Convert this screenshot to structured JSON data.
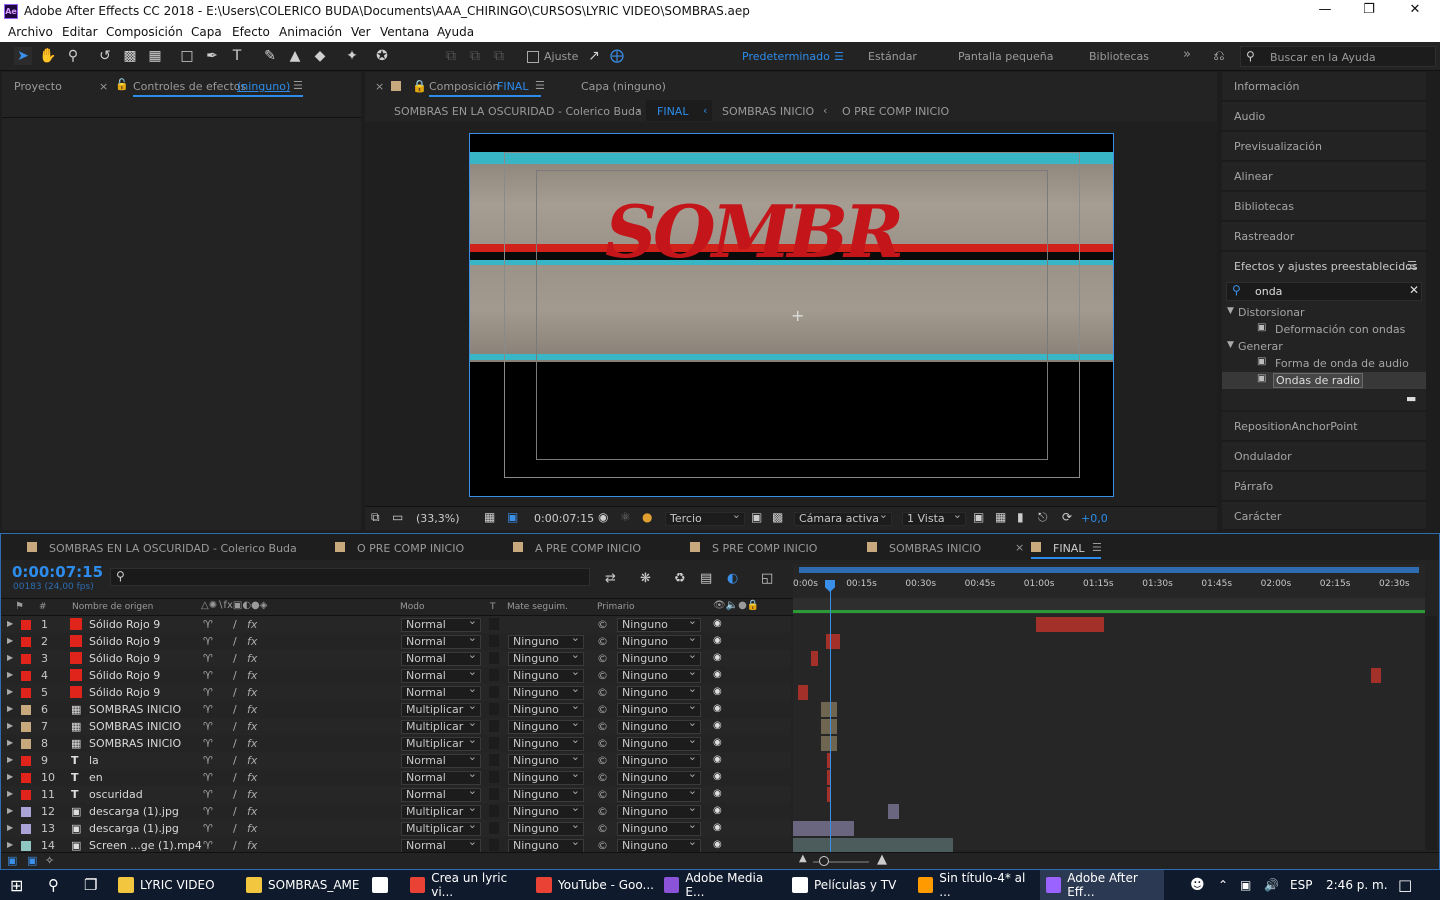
{
  "window": {
    "title": "Adobe After Effects CC 2018 - E:\\Users\\COLERICO BUDA\\Documents\\AAA_CHIRINGO\\CURSOS\\LYRIC VIDEO\\SOMBRAS.aep",
    "logo": "Ae"
  },
  "menu": [
    "Archivo",
    "Editar",
    "Composición",
    "Capa",
    "Efecto",
    "Animación",
    "Ver",
    "Ventana",
    "Ayuda"
  ],
  "toolbar": {
    "ajuste": "Ajuste",
    "workspaces": [
      "Predeterminado",
      "Estándar",
      "Pantalla pequeña",
      "Bibliotecas"
    ],
    "search_placeholder": "Buscar en la Ayuda"
  },
  "left_panel": {
    "tab_project": "Proyecto",
    "tab_effects": "Controles de efectos",
    "effects_target": "(ninguno)"
  },
  "comp_panel": {
    "tab_label": "Composición",
    "tab_name": "FINAL",
    "layer_tab": "Capa (ninguno)",
    "breadcrumbs": [
      "SOMBRAS EN LA OSCURIDAD  - Colerico Buda",
      "FINAL",
      "SOMBRAS INICIO",
      "O PRE COMP INICIO"
    ],
    "zoom": "(33,3%)",
    "timecode": "0:00:07:15",
    "grid": "Tercio",
    "camera": "Cámara activa",
    "views": "1 Vista",
    "exposure": "+0,0",
    "canvas_text": "SOMBR"
  },
  "right_panel": {
    "items_top": [
      "Información",
      "Audio",
      "Previsualización",
      "Alinear",
      "Bibliotecas",
      "Rastreador"
    ],
    "effects_title": "Efectos y ajustes preestablecidos",
    "search_value": "onda",
    "tree": [
      {
        "cat": "Distorsionar",
        "items": [
          "Deformación con ondas"
        ]
      },
      {
        "cat": "Generar",
        "items": [
          "Forma de onda de audio",
          "Ondas de radio"
        ]
      }
    ],
    "items_bottom": [
      "RepositionAnchorPoint",
      "Ondulador",
      "Párrafo",
      "Carácter"
    ]
  },
  "timeline": {
    "tabs": [
      "SOMBRAS EN LA OSCURIDAD  - Colerico Buda",
      "O PRE COMP INICIO",
      "A PRE COMP INICIO",
      "S PRE COMP INICIO",
      "SOMBRAS INICIO",
      "FINAL"
    ],
    "timecode": "0:00:07:15",
    "frames": "00183 (24,00 fps)",
    "col_headers": {
      "num": "#",
      "source": "Nombre de origen",
      "mode": "Modo",
      "t": "T",
      "trkmat": "Mate seguim.",
      "parent": "Primario"
    },
    "ruler": [
      "0:00s",
      "00:15s",
      "00:30s",
      "00:45s",
      "01:00s",
      "01:15s",
      "01:30s",
      "01:45s",
      "02:00s",
      "02:15s",
      "02:30s"
    ],
    "layers": [
      {
        "n": "1",
        "name": "Sólido Rojo 9",
        "mode": "Normal",
        "trk": "",
        "parent": "Ninguno",
        "color": "#e0241c",
        "type": "solid",
        "bar": [
          0.385,
          0.107
        ],
        "barcolor": "#a3312a"
      },
      {
        "n": "2",
        "name": "Sólido Rojo 9",
        "mode": "Normal",
        "trk": "Ninguno",
        "parent": "Ninguno",
        "color": "#e0241c",
        "type": "solid",
        "bar": [
          0.053,
          0.021
        ],
        "barcolor": "#a3312a"
      },
      {
        "n": "3",
        "name": "Sólido Rojo 9",
        "mode": "Normal",
        "trk": "Ninguno",
        "parent": "Ninguno",
        "color": "#e0241c",
        "type": "solid",
        "bar": [
          0.028,
          0.011
        ],
        "barcolor": "#a3312a"
      },
      {
        "n": "4",
        "name": "Sólido Rojo 9",
        "mode": "Normal",
        "trk": "Ninguno",
        "parent": "Ninguno",
        "color": "#e0241c",
        "type": "solid",
        "bar": [
          0.914,
          0.016
        ],
        "barcolor": "#a3312a"
      },
      {
        "n": "5",
        "name": "Sólido Rojo 9",
        "mode": "Normal",
        "trk": "Ninguno",
        "parent": "Ninguno",
        "color": "#e0241c",
        "type": "solid",
        "bar": [
          0.008,
          0.016
        ],
        "barcolor": "#a3312a"
      },
      {
        "n": "6",
        "name": "SOMBRAS INICIO",
        "mode": "Multiplicar",
        "trk": "Ninguno",
        "parent": "Ninguno",
        "color": "#c8a97e",
        "type": "comp",
        "bar": [
          0.044,
          0.026
        ],
        "barcolor": "#6e6650"
      },
      {
        "n": "7",
        "name": "SOMBRAS INICIO",
        "mode": "Multiplicar",
        "trk": "Ninguno",
        "parent": "Ninguno",
        "color": "#c8a97e",
        "type": "comp",
        "bar": [
          0.044,
          0.026
        ],
        "barcolor": "#6e6650"
      },
      {
        "n": "8",
        "name": "SOMBRAS INICIO",
        "mode": "Multiplicar",
        "trk": "Ninguno",
        "parent": "Ninguno",
        "color": "#c8a97e",
        "type": "comp",
        "bar": [
          0.044,
          0.026
        ],
        "barcolor": "#6e6650"
      },
      {
        "n": "9",
        "name": "la",
        "mode": "Normal",
        "trk": "Ninguno",
        "parent": "Ninguno",
        "color": "#e0241c",
        "type": "text",
        "bar": [
          0.054,
          0.004
        ],
        "barcolor": "#a3312a"
      },
      {
        "n": "10",
        "name": "en",
        "mode": "Normal",
        "trk": "Ninguno",
        "parent": "Ninguno",
        "color": "#e0241c",
        "type": "text",
        "bar": [
          0.054,
          0.004
        ],
        "barcolor": "#a3312a"
      },
      {
        "n": "11",
        "name": "oscuridad",
        "mode": "Normal",
        "trk": "Ninguno",
        "parent": "Ninguno",
        "color": "#e0241c",
        "type": "text",
        "bar": [
          0.054,
          0.004
        ],
        "barcolor": "#a3312a"
      },
      {
        "n": "12",
        "name": "descarga (1).jpg",
        "mode": "Multiplicar",
        "trk": "Ninguno",
        "parent": "Ninguno",
        "color": "#a9a3d8",
        "type": "img",
        "bar": [
          0.151,
          0.016
        ],
        "barcolor": "#6a6680"
      },
      {
        "n": "13",
        "name": "descarga (1).jpg",
        "mode": "Multiplicar",
        "trk": "Ninguno",
        "parent": "Ninguno",
        "color": "#a9a3d8",
        "type": "img",
        "bar": [
          0.0,
          0.096
        ],
        "barcolor": "#6a6680"
      },
      {
        "n": "14",
        "name": "Screen ...ge (1).mp4",
        "mode": "Normal",
        "trk": "Ninguno",
        "parent": "Ninguno",
        "color": "#8fc6c2",
        "type": "img",
        "bar": [
          0.0,
          0.253
        ],
        "barcolor": "#4c5c5c"
      }
    ]
  },
  "taskbar": {
    "items": [
      {
        "label": "LYRIC VIDEO",
        "color": "#f3c640"
      },
      {
        "label": "SOMBRAS_AME",
        "color": "#f3c640"
      },
      {
        "label": "",
        "color": "#ffffff"
      },
      {
        "label": "Crea un lyric vi...",
        "color": "#ea4335"
      },
      {
        "label": "YouTube - Goo...",
        "color": "#ea4335"
      },
      {
        "label": "Adobe Media E...",
        "color": "#8a53d8"
      },
      {
        "label": "Películas y TV",
        "color": "#ffffff"
      },
      {
        "label": "Sin título-4* al ...",
        "color": "#ff9a00"
      },
      {
        "label": "Adobe After Eff...",
        "color": "#9a63ff"
      }
    ],
    "lang": "ESP",
    "clock": "2:46 p. m."
  }
}
